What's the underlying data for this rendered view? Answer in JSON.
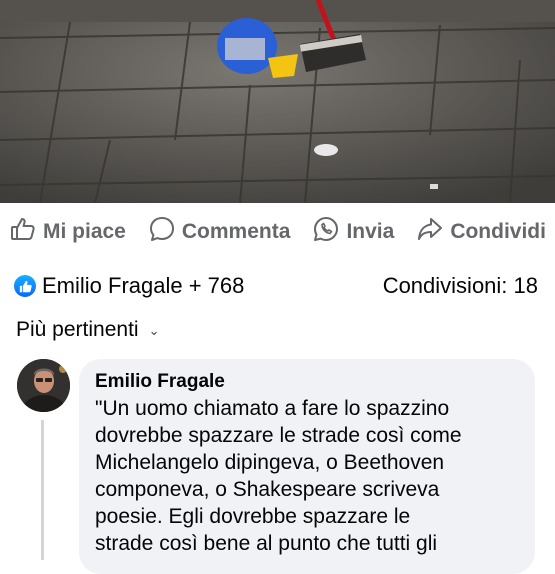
{
  "actions": {
    "like": "Mi piace",
    "comment": "Commenta",
    "send": "Invia",
    "share": "Condividi"
  },
  "reactions": {
    "summary": "Emilio Fragale + 768",
    "shares": "Condivisioni: 18"
  },
  "sort": {
    "label": "Più pertinenti"
  },
  "comment": {
    "author": "Emilio Fragale",
    "lines": [
      "\"Un uomo chiamato a fare lo spazzino",
      "dovrebbe spazzare le strade così come",
      "Michelangelo dipingeva, o Beethoven",
      "componeva, o Shakespeare scriveva",
      "poesie. Egli dovrebbe spazzare le",
      "strade così bene al punto che tutti gli"
    ]
  },
  "colors": {
    "muted": "#65676b",
    "like_blue": "#0866ff",
    "bubble_bg": "#f0f2f5"
  },
  "icons": [
    "thumbs-up-icon",
    "comment-icon",
    "whatsapp-icon",
    "share-icon",
    "like-badge-icon",
    "chevron-down-icon"
  ]
}
